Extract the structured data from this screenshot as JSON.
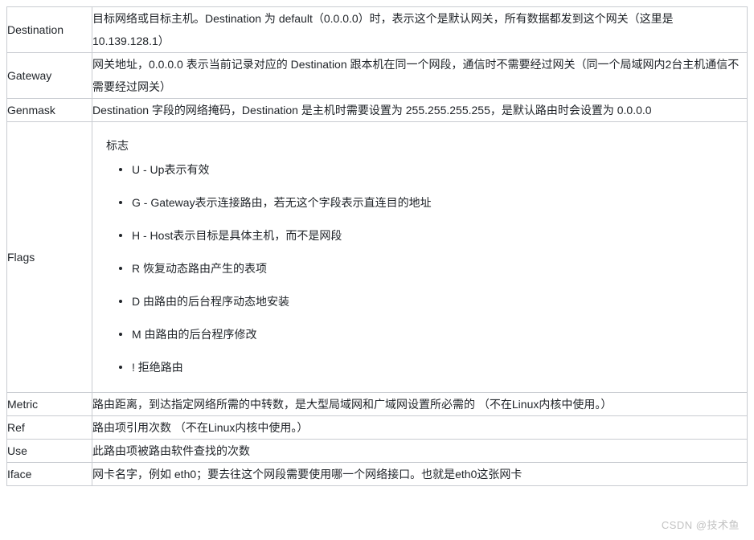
{
  "document": {
    "type": "reference-table",
    "watermark": "CSDN @技术鱼",
    "rows": [
      {
        "field": "Destination",
        "description": "目标网络或目标主机。Destination 为 default（0.0.0.0）时，表示这个是默认网关，所有数据都发到这个网关（这里是 10.139.128.1）"
      },
      {
        "field": "Gateway",
        "description": "网关地址，0.0.0.0 表示当前记录对应的 Destination 跟本机在同一个网段，通信时不需要经过网关（同一个局域网内2台主机通信不需要经过网关）"
      },
      {
        "field": "Genmask",
        "description": "Destination 字段的网络掩码，Destination 是主机时需要设置为 255.255.255.255，是默认路由时会设置为 0.0.0.0"
      },
      {
        "field": "Flags",
        "title": "标志",
        "items": [
          "U - Up表示有效",
          "G - Gateway表示连接路由，若无这个字段表示直连目的地址",
          "H - Host表示目标是具体主机，而不是网段",
          "R 恢复动态路由产生的表项",
          "D 由路由的后台程序动态地安装",
          "M 由路由的后台程序修改",
          "! 拒绝路由"
        ]
      },
      {
        "field": "Metric",
        "description": "路由距离，到达指定网络所需的中转数，是大型局域网和广域网设置所必需的 （不在Linux内核中使用。）"
      },
      {
        "field": "Ref",
        "description": "路由项引用次数 （不在Linux内核中使用。）"
      },
      {
        "field": "Use",
        "description": "此路由项被路由软件查找的次数"
      },
      {
        "field": "Iface",
        "description": "网卡名字，例如 eth0；要去往这个网段需要使用哪一个网络接口。也就是eth0这张网卡"
      }
    ]
  }
}
